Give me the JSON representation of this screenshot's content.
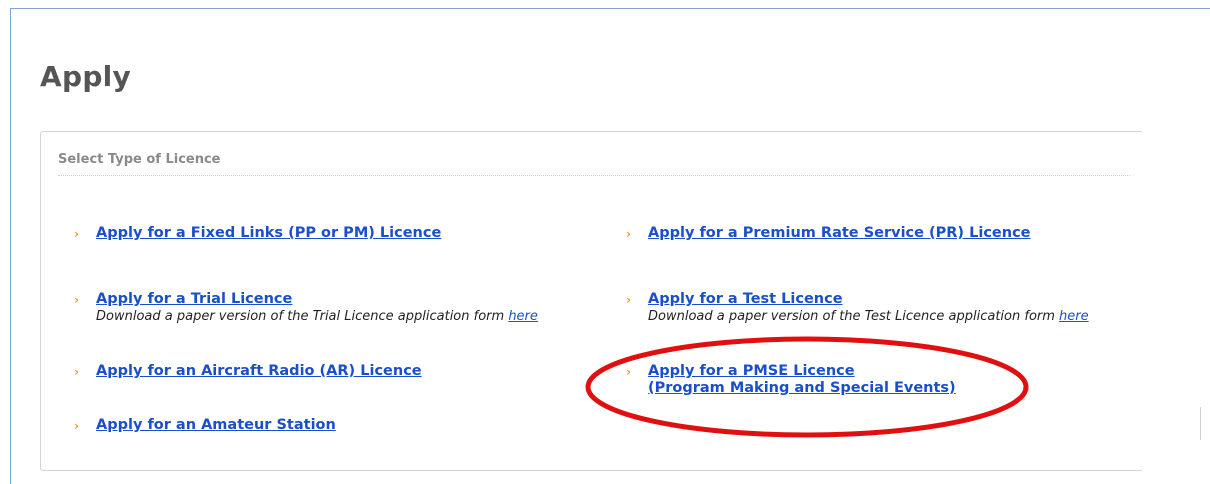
{
  "page": {
    "title": "Apply"
  },
  "panel": {
    "heading": "Select Type of Licence",
    "bullet_glyph": "›",
    "left_items": [
      {
        "link": "Apply for a Fixed Links (PP or PM) Licence"
      },
      {
        "link": "Apply for a Trial Licence",
        "desc_before": "Download a paper version of the Trial Licence application form ",
        "desc_link": "here"
      },
      {
        "link": "Apply for an Aircraft Radio (AR) Licence"
      },
      {
        "link": "Apply for an Amateur Station"
      }
    ],
    "right_items": [
      {
        "link": "Apply for a Premium Rate Service (PR) Licence"
      },
      {
        "link": "Apply for a Test Licence",
        "desc_before": "Download a paper version of the Test Licence application form ",
        "desc_link": "here"
      },
      {
        "link_line1": "Apply for a PMSE Licence",
        "link_line2": "(Program Making and Special Events)"
      }
    ]
  },
  "colors": {
    "link": "#1a4fc9",
    "bullet": "#f0a020",
    "annotation": "#e01010",
    "frame": "#7fa3c9"
  }
}
